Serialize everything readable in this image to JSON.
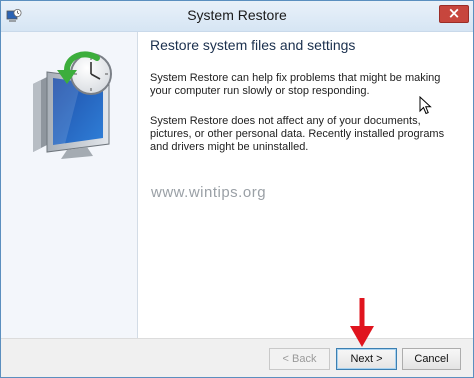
{
  "window": {
    "title": "System Restore"
  },
  "content": {
    "heading": "Restore system files and settings",
    "paragraph1": "System Restore can help fix problems that might be making your computer run slowly or stop responding.",
    "paragraph2": "System Restore does not affect any of your documents, pictures, or other personal data. Recently installed programs and drivers might be uninstalled."
  },
  "watermark": "www.wintips.org",
  "buttons": {
    "back": "< Back",
    "next": "Next >",
    "cancel": "Cancel"
  },
  "icons": {
    "close": "close-icon",
    "wizard": "system-restore-icon",
    "cursor": "mouse-pointer-icon",
    "annotation": "red-arrow-icon"
  },
  "colors": {
    "accent": "#3c7fb1",
    "close": "#c7463d",
    "annotation": "#e0141e"
  }
}
